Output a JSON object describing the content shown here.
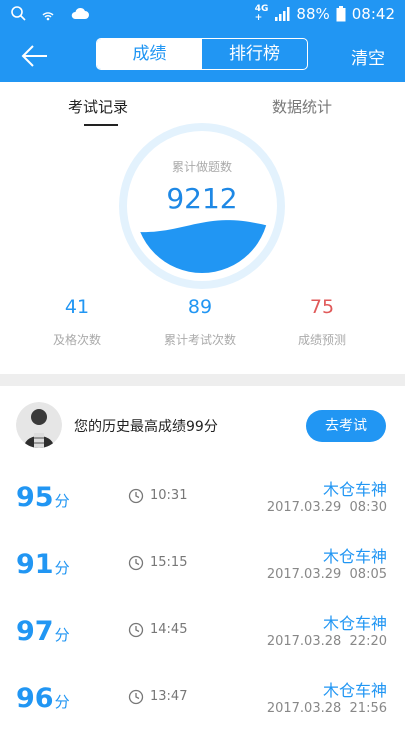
{
  "status_bar": {
    "network": "4G",
    "signal_sub": "+",
    "battery": "88%",
    "time": "08:42",
    "icons": [
      "search-icon",
      "wifi-signal-icon",
      "cloud-icon",
      "signal-bars-icon",
      "battery-icon"
    ]
  },
  "nav": {
    "segments": [
      "成绩",
      "排行榜"
    ],
    "active_segment": "成绩",
    "right_action": "清空",
    "colors": {
      "primary": "#2196f3",
      "danger": "#e05a5a"
    }
  },
  "tabs": [
    "考试记录",
    "数据统计"
  ],
  "gauge": {
    "label": "累计做题数",
    "value": "9212",
    "fill_fraction": 0.35
  },
  "stats": [
    {
      "value": "41",
      "label": "及格次数"
    },
    {
      "value": "89",
      "label": "累计考试次数"
    },
    {
      "value": "75",
      "label": "成绩预测"
    }
  ],
  "profile": {
    "best_text": "您的历史最高成绩99分",
    "button": "去考试"
  },
  "score_unit": "分",
  "records": [
    {
      "score": "95",
      "time": "10:31",
      "user": "木仓车神",
      "date": "2017.03.29  08:30"
    },
    {
      "score": "91",
      "time": "15:15",
      "user": "木仓车神",
      "date": "2017.03.29  08:05"
    },
    {
      "score": "97",
      "time": "14:45",
      "user": "木仓车神",
      "date": "2017.03.28  22:20"
    },
    {
      "score": "96",
      "time": "13:47",
      "user": "木仓车神",
      "date": "2017.03.28  21:56"
    }
  ]
}
